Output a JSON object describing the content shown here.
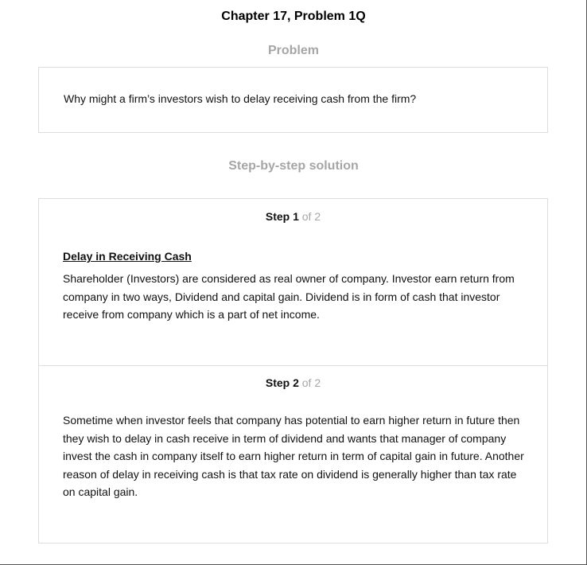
{
  "header": {
    "title": "Chapter 17, Problem 1Q"
  },
  "problem": {
    "heading": "Problem",
    "question": "Why might a firm’s investors wish to delay receiving cash from the firm?"
  },
  "solution": {
    "heading": "Step-by-step solution",
    "steps": [
      {
        "step_word": "Step 1",
        "of_text": " of 2",
        "subtitle": "Delay in Receiving Cash",
        "body": "Shareholder (Investors) are considered as real owner of company. Investor earn return from company in two ways, Dividend and capital gain. Dividend is in form of cash that investor receive from company which is a part of net income."
      },
      {
        "step_word": "Step 2",
        "of_text": " of 2",
        "body": "Sometime when investor feels that company has potential to earn higher return in future then they wish to delay in cash receive in term of dividend and wants that manager of company invest the cash in company itself to earn higher return in term of capital gain in future. Another reason of delay in receiving cash is that tax rate on dividend is generally higher than tax rate on capital gain."
      }
    ]
  },
  "colors": {
    "heading_gray": "#a6a6a6",
    "border": "#dddddd",
    "text": "#111111"
  }
}
